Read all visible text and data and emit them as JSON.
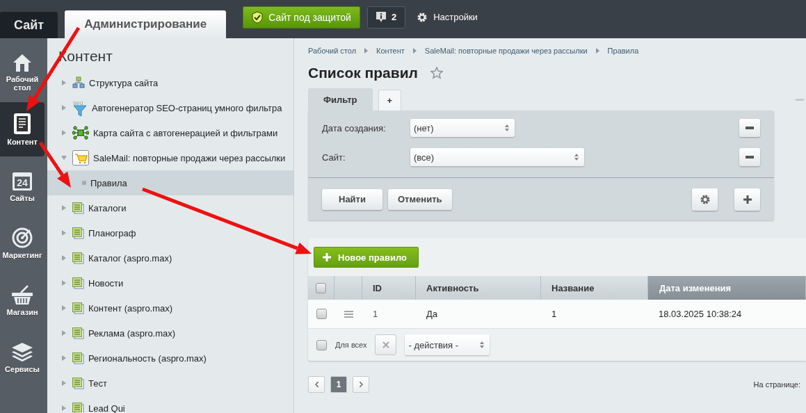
{
  "top_bar": {
    "tabs": [
      {
        "label": "Сайт",
        "selected": false
      },
      {
        "label": "Администрирование",
        "selected": true
      }
    ],
    "security_button": "Сайт под защитой",
    "notifications": "2",
    "settings": "Настройки"
  },
  "rail": [
    {
      "label": "Рабочий стол",
      "kind": "home",
      "selected": false
    },
    {
      "label": "Контент",
      "kind": "document",
      "selected": true
    },
    {
      "label": "Сайты",
      "kind": "calendar",
      "icon_text": "24",
      "selected": false
    },
    {
      "label": "Маркетинг",
      "kind": "target",
      "selected": false
    },
    {
      "label": "Магазин",
      "kind": "basket",
      "selected": false
    },
    {
      "label": "Сервисы",
      "kind": "layers",
      "selected": false
    }
  ],
  "tree": {
    "title": "Контент",
    "items": [
      {
        "label": "Структура сайта",
        "kind": "structure",
        "expanded": false,
        "selected": false
      },
      {
        "label": "Автогенератор SEO-страниц умного фильтра",
        "kind": "seo",
        "icon_text": "seo",
        "expanded": false,
        "selected": false
      },
      {
        "label": "Карта сайта с автогенерацией и фильтрами",
        "kind": "sitemap",
        "expanded": false,
        "selected": false
      },
      {
        "label": "SaleMail: повторные продажи через рассылки",
        "kind": "cart",
        "expanded": true,
        "selected": false,
        "children": [
          {
            "label": "Правила",
            "kind": "leaf",
            "expanded": false,
            "selected": true
          }
        ]
      },
      {
        "label": "Каталоги",
        "kind": "iblock",
        "expanded": false,
        "selected": false
      },
      {
        "label": "Планограф",
        "kind": "iblock",
        "expanded": false,
        "selected": false
      },
      {
        "label": "Каталог (aspro.max)",
        "kind": "iblock",
        "expanded": false,
        "selected": false
      },
      {
        "label": "Новости",
        "kind": "iblock",
        "expanded": false,
        "selected": false
      },
      {
        "label": "Контент (aspro.max)",
        "kind": "iblock",
        "expanded": false,
        "selected": false
      },
      {
        "label": "Реклама (aspro.max)",
        "kind": "iblock",
        "expanded": false,
        "selected": false
      },
      {
        "label": "Региональность (aspro.max)",
        "kind": "iblock",
        "expanded": false,
        "selected": false
      },
      {
        "label": "Тест",
        "kind": "iblock",
        "expanded": false,
        "selected": false
      },
      {
        "label": "Lead Qui",
        "kind": "iblock",
        "expanded": false,
        "selected": false
      }
    ]
  },
  "breadcrumbs": [
    "Рабочий стол",
    "Контент",
    "SaleMail: повторные продажи через рассылки",
    "Правила"
  ],
  "page_title": "Список правил",
  "filter": {
    "tab": "Фильтр",
    "add_tab": "+",
    "fields": [
      {
        "label": "Дата создания:",
        "value": "(нет)",
        "wide": false
      },
      {
        "label": "Сайт:",
        "value": "(все)",
        "wide": true
      }
    ],
    "find_button": "Найти",
    "cancel_button": "Отменить"
  },
  "new_button": "Новое правило",
  "table": {
    "select_all": false,
    "columns": [
      {
        "label": "ID",
        "sorted": false
      },
      {
        "label": "Активность",
        "sorted": false
      },
      {
        "label": "Название",
        "sorted": false
      },
      {
        "label": "Дата изменения",
        "sorted": true
      }
    ],
    "rows": [
      {
        "checked": false,
        "cells": [
          "1",
          "Да",
          "1",
          "18.03.2025 10:38:24"
        ]
      }
    ],
    "footer": {
      "checked": false,
      "label": "Для всех",
      "action": "- действия -"
    }
  },
  "pagination": {
    "pages": [
      {
        "label": "1",
        "selected": true
      }
    ],
    "per_page": "На странице:"
  }
}
